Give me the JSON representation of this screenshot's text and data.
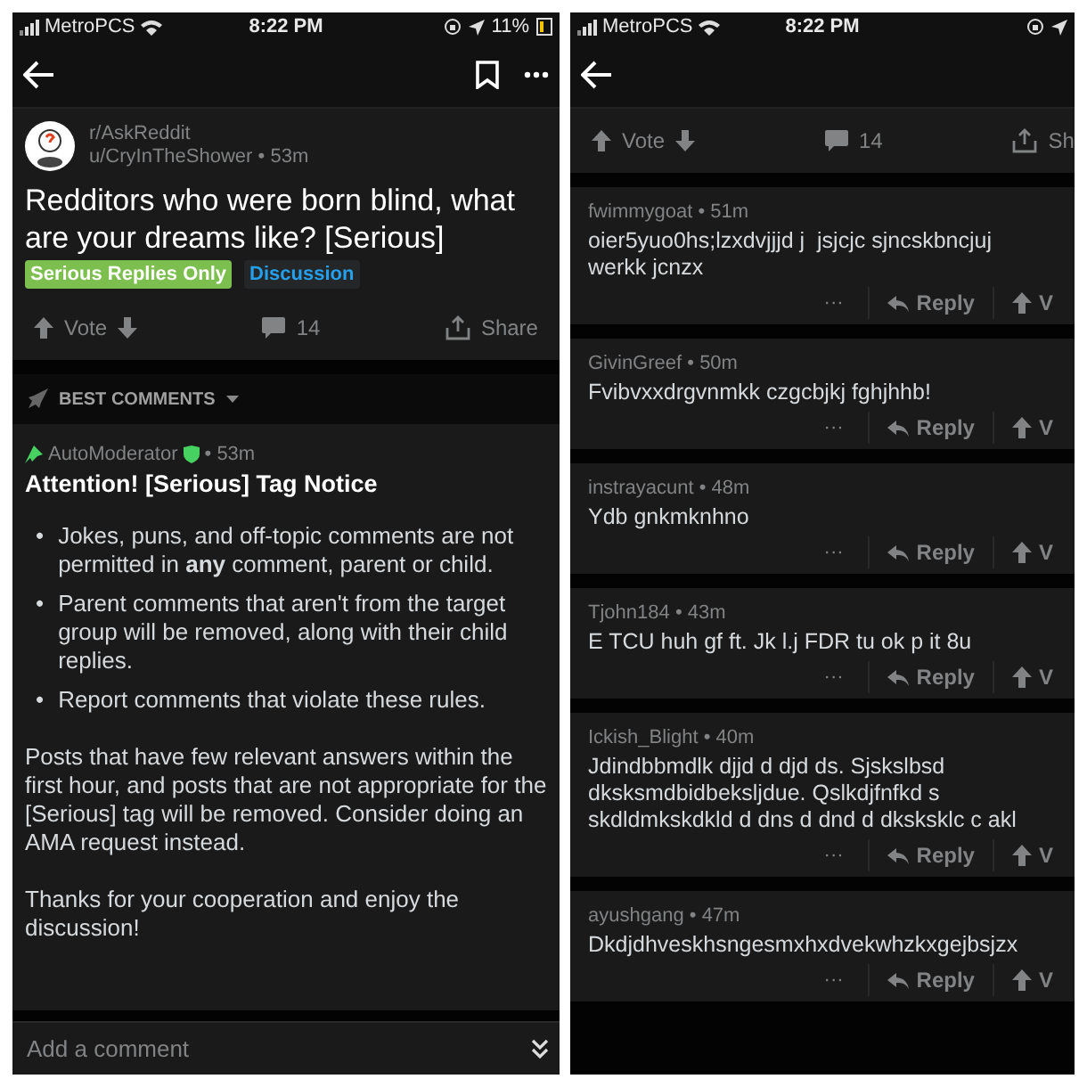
{
  "left": {
    "status": {
      "carrier": "MetroPCS",
      "time": "8:22 PM",
      "battery": "11%"
    },
    "post": {
      "subreddit": "r/AskReddit",
      "author": "u/CryInTheShower",
      "separator": "•",
      "age": "53m",
      "title": "Redditors who were born blind, what are your dreams like? [Serious]",
      "flairs": [
        {
          "label": "Serious Replies Only",
          "color": "#7cbf4f"
        },
        {
          "label": "Discussion",
          "color": "#24a0ed"
        }
      ],
      "actions": {
        "vote": "Vote",
        "comments": "14",
        "share": "Share"
      }
    },
    "sort": "BEST COMMENTS",
    "automod": {
      "author": "AutoModerator",
      "separator": "•",
      "age": "53m",
      "pinned": true,
      "moderator": true,
      "heading": "Attention! [Serious] Tag Notice",
      "bullets": [
        {
          "marker": "•",
          "text": "Jokes, puns, and off-topic comments are not permitted in **any** comment, parent or child."
        },
        {
          "marker": "•",
          "text": "Parent comments that aren't from the target group will be removed, along with their child replies."
        },
        {
          "marker": "•",
          "text": "Report comments that violate these rules."
        }
      ],
      "paragraphs": [
        "Posts that have few relevant answers within the first hour, and posts that are not appropriate for the [Serious] tag will be removed. Consider doing an AMA request instead.",
        "Thanks for your cooperation and enjoy the discussion!"
      ]
    },
    "composer": {
      "placeholder": "Add a comment"
    }
  },
  "right": {
    "status": {
      "carrier": "MetroPCS",
      "time": "8:22 PM"
    },
    "actions": {
      "vote": "Vote",
      "comments": "14",
      "share": "Sh"
    },
    "comments": [
      {
        "author": "fwimmygoat",
        "separator": "•",
        "age": "51m",
        "body": "oier5yuo0hs;lzxdvjjjd j  jsjcjc sjncskbncjuj werkk jcnzx",
        "more": "···",
        "reply": "Reply",
        "vote": "V"
      },
      {
        "author": "GivinGreef",
        "separator": "•",
        "age": "50m",
        "body": "Fvibvxxdrgvnmkk czgcbjkj fghjhhb!",
        "more": "···",
        "reply": "Reply",
        "vote": "V"
      },
      {
        "author": "instrayacunt",
        "separator": "•",
        "age": "48m",
        "body": "Ydb gnkmknhno",
        "more": "···",
        "reply": "Reply",
        "vote": "V"
      },
      {
        "author": "Tjohn184",
        "separator": "•",
        "age": "43m",
        "body": "E TCU huh gf ft. Jk l.j FDR tu ok p it 8u",
        "more": "···",
        "reply": "Reply",
        "vote": "V"
      },
      {
        "author": "Ickish_Blight",
        "separator": "•",
        "age": "40m",
        "body": "Jdindbbmdlk djjd d djd ds. Sjskslbsd dksksmdbidbeksljdue. Qslkdjfnfkd s skdldmkskdkld d dns d dnd d dksksklc c akl",
        "more": "···",
        "reply": "Reply",
        "vote": "V"
      },
      {
        "author": "ayushgang",
        "separator": "•",
        "age": "47m",
        "body": "Dkdjdhveskhsngesmxhxdvekwhzkxgejbsjzx",
        "more": "···",
        "reply": "Reply",
        "vote": "V"
      }
    ]
  }
}
